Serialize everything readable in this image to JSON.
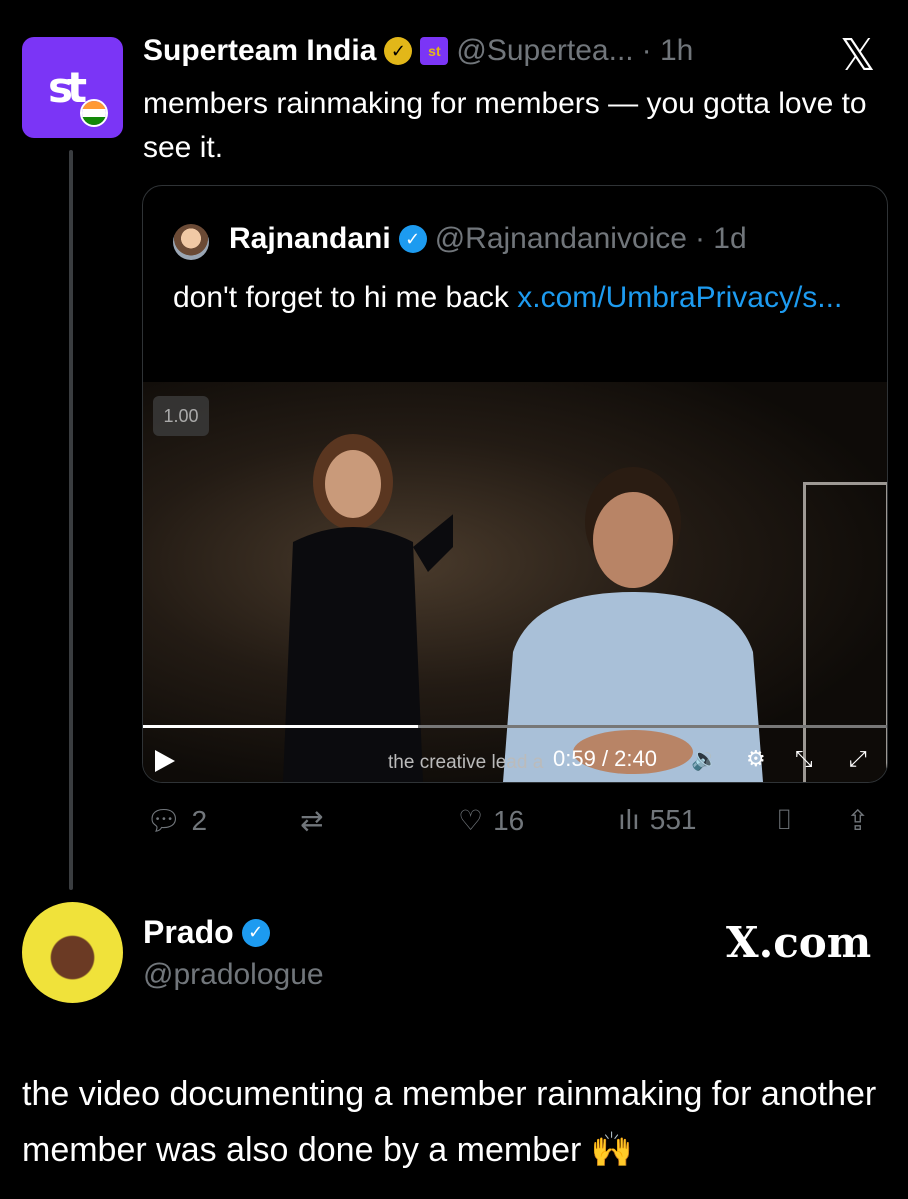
{
  "tweet": {
    "author_name": "Superteam India",
    "handle": "@Supertea...",
    "time": "· 1h",
    "avatar_text": "st",
    "text": "members rainmaking for members — you gotta love to see it.",
    "close_icon": "x-logo"
  },
  "quote": {
    "author_name": "Rajnandani",
    "handle": "@Rajnandanivoice",
    "time": "· 1d",
    "text": "don't forget to hi me back",
    "link_text": "x.com/UmbraPrivacy/s...",
    "video": {
      "speed": "1.00",
      "caption": "the creative lead a",
      "time_current": "0:59",
      "time_total": "2:40",
      "progress": 0.37
    }
  },
  "actions": {
    "replies": "2",
    "retweets": "",
    "likes": "16",
    "views": "551"
  },
  "post": {
    "author_name": "Prado",
    "handle": "@pradologue",
    "watermark": "X.com",
    "text": "the video documenting a member rainmaking for another member was also done by a member 🙌"
  }
}
